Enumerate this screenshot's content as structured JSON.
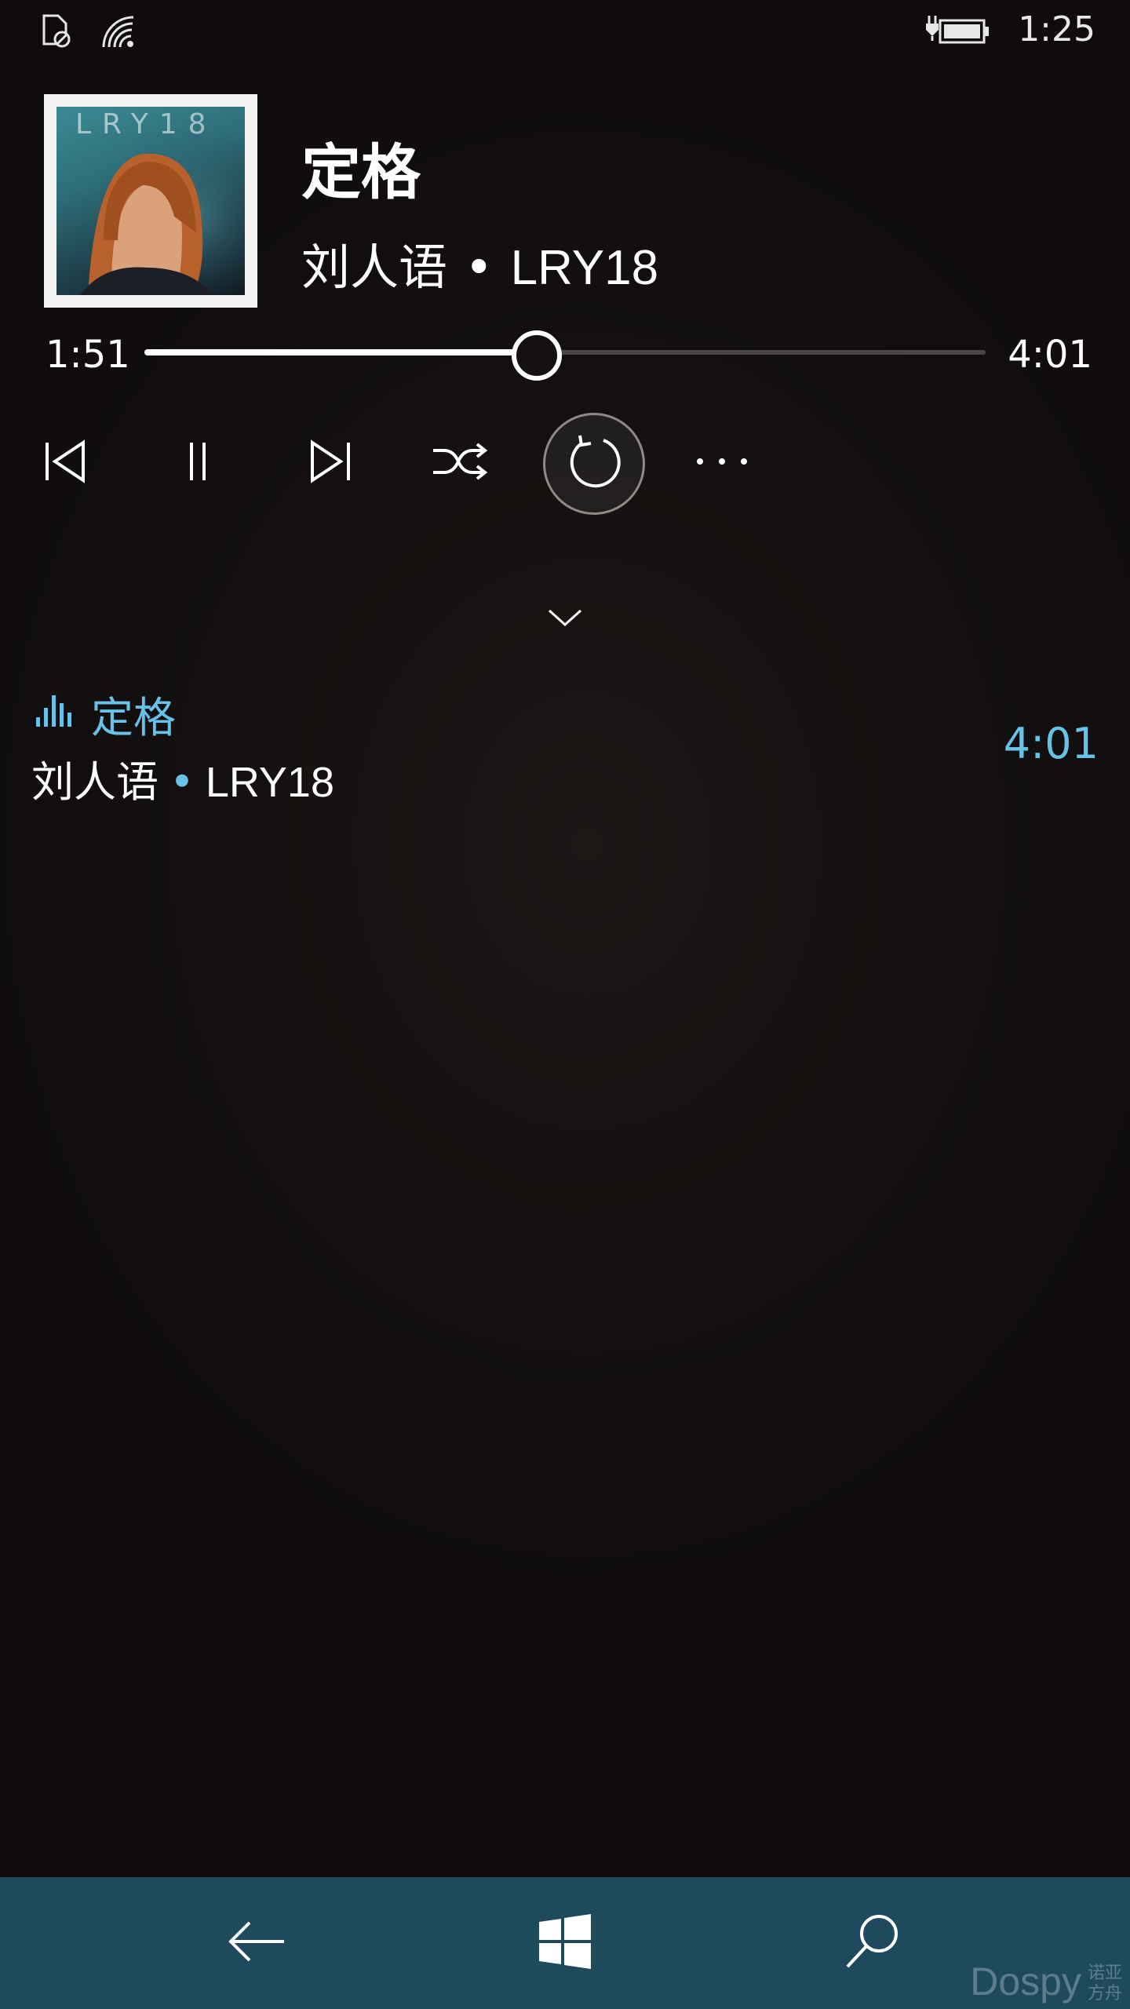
{
  "status_bar": {
    "time": "1:25",
    "icons": [
      "no-sim-icon",
      "wifi-icon",
      "battery-charging-icon"
    ]
  },
  "now_playing": {
    "album_art_text": "LRY18",
    "title": "定格",
    "artist": "刘人语",
    "album": "LRY18",
    "separator": "•",
    "elapsed": "1:51",
    "duration": "4:01",
    "progress": 0.465
  },
  "controls": {
    "icons": [
      "previous-icon",
      "pause-icon",
      "next-icon",
      "shuffle-icon",
      "repeat-icon",
      "more-icon"
    ],
    "repeat_active": true
  },
  "queue": {
    "items": [
      {
        "title": "定格",
        "artist": "刘人语",
        "album": "LRY18",
        "separator": "•",
        "duration": "4:01",
        "now_playing": true
      }
    ]
  },
  "nav_bar": {
    "icons": [
      "back-icon",
      "windows-icon",
      "search-icon"
    ]
  },
  "watermark": {
    "text": "Dospy",
    "sub_line_1": "诺亚",
    "sub_line_2": "方舟"
  },
  "colors": {
    "accent": "#66c2e8",
    "nav_bar": "#1f4a5c",
    "background": "#141110"
  }
}
